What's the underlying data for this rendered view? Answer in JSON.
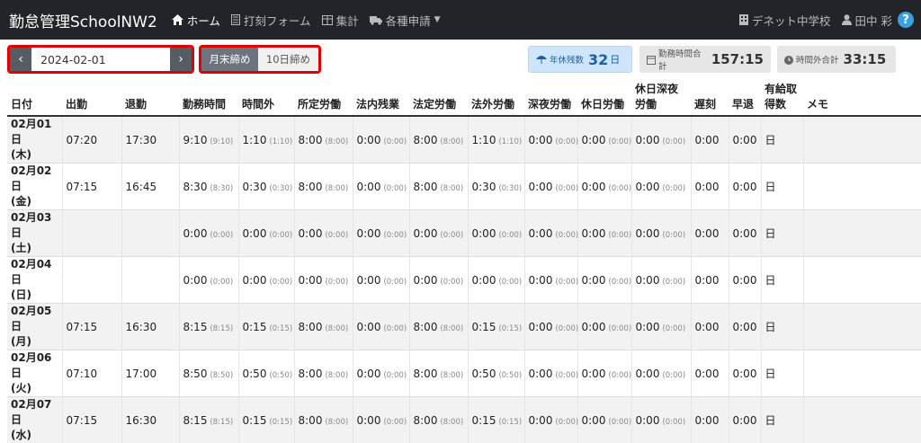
{
  "app": {
    "title": "勤怠管理SchoolNW2"
  },
  "nav": {
    "home": "ホーム",
    "punch": "打刻フォーム",
    "summary": "集計",
    "requests": "各種申請",
    "school": "デネット中学校",
    "user": "田中 彩",
    "help": "?"
  },
  "toolbar": {
    "date": "2024-02-01",
    "close_month_end": "月末締め",
    "close_10th": "10日締め"
  },
  "stats": {
    "annual_leave_label": "年休残数",
    "annual_leave_value": "32",
    "annual_leave_unit": "日",
    "work_total_label": "勤務時間合計",
    "work_total_value": "157:15",
    "overtime_total_label": "時間外合計",
    "overtime_total_value": "33:15"
  },
  "table": {
    "headers": [
      "日付",
      "出勤",
      "退勤",
      "勤務時間",
      "時間外",
      "所定労働",
      "法内残業",
      "法定労働",
      "法外労働",
      "深夜労働",
      "休日労働",
      "休日深夜労働",
      "遅刻",
      "早退",
      "有給取得数",
      "メモ"
    ],
    "rows": [
      {
        "date": "02月01日",
        "dow": "(木)",
        "in": "07:20",
        "out": "17:30",
        "work": "9:10",
        "work_s": "(9:10)",
        "ot": "1:10",
        "ot_s": "(1:10)",
        "sch": "8:00",
        "sch_s": "(8:00)",
        "inlaw": "0:00",
        "inlaw_s": "(0:00)",
        "legal": "8:00",
        "legal_s": "(8:00)",
        "outlaw": "1:10",
        "outlaw_s": "(1:10)",
        "night": "0:00",
        "night_s": "(0:00)",
        "hol": "0:00",
        "hol_s": "(0:00)",
        "holnight": "0:00",
        "holnight_s": "(0:00)",
        "late": "0:00",
        "early": "0:00",
        "paid": "日",
        "memo": ""
      },
      {
        "date": "02月02日",
        "dow": "(金)",
        "in": "07:15",
        "out": "16:45",
        "work": "8:30",
        "work_s": "(8:30)",
        "ot": "0:30",
        "ot_s": "(0:30)",
        "sch": "8:00",
        "sch_s": "(8:00)",
        "inlaw": "0:00",
        "inlaw_s": "(0:00)",
        "legal": "8:00",
        "legal_s": "(8:00)",
        "outlaw": "0:30",
        "outlaw_s": "(0:30)",
        "night": "0:00",
        "night_s": "(0:00)",
        "hol": "0:00",
        "hol_s": "(0:00)",
        "holnight": "0:00",
        "holnight_s": "(0:00)",
        "late": "0:00",
        "early": "0:00",
        "paid": "日",
        "memo": ""
      },
      {
        "date": "02月03日",
        "dow": "(土)",
        "in": "",
        "out": "",
        "work": "0:00",
        "work_s": "(0:00)",
        "ot": "0:00",
        "ot_s": "(0:00)",
        "sch": "0:00",
        "sch_s": "(0:00)",
        "inlaw": "0:00",
        "inlaw_s": "(0:00)",
        "legal": "0:00",
        "legal_s": "(0:00)",
        "outlaw": "0:00",
        "outlaw_s": "(0:00)",
        "night": "0:00",
        "night_s": "(0:00)",
        "hol": "0:00",
        "hol_s": "(0:00)",
        "holnight": "0:00",
        "holnight_s": "(0:00)",
        "late": "0:00",
        "early": "0:00",
        "paid": "日",
        "memo": ""
      },
      {
        "date": "02月04日",
        "dow": "(日)",
        "in": "",
        "out": "",
        "work": "0:00",
        "work_s": "(0:00)",
        "ot": "0:00",
        "ot_s": "(0:00)",
        "sch": "0:00",
        "sch_s": "(0:00)",
        "inlaw": "0:00",
        "inlaw_s": "(0:00)",
        "legal": "0:00",
        "legal_s": "(0:00)",
        "outlaw": "0:00",
        "outlaw_s": "(0:00)",
        "night": "0:00",
        "night_s": "(0:00)",
        "hol": "0:00",
        "hol_s": "(0:00)",
        "holnight": "0:00",
        "holnight_s": "(0:00)",
        "late": "0:00",
        "early": "0:00",
        "paid": "日",
        "memo": ""
      },
      {
        "date": "02月05日",
        "dow": "(月)",
        "in": "07:15",
        "out": "16:30",
        "work": "8:15",
        "work_s": "(8:15)",
        "ot": "0:15",
        "ot_s": "(0:15)",
        "sch": "8:00",
        "sch_s": "(8:00)",
        "inlaw": "0:00",
        "inlaw_s": "(0:00)",
        "legal": "8:00",
        "legal_s": "(8:00)",
        "outlaw": "0:15",
        "outlaw_s": "(0:15)",
        "night": "0:00",
        "night_s": "(0:00)",
        "hol": "0:00",
        "hol_s": "(0:00)",
        "holnight": "0:00",
        "holnight_s": "(0:00)",
        "late": "0:00",
        "early": "0:00",
        "paid": "日",
        "memo": ""
      },
      {
        "date": "02月06日",
        "dow": "(火)",
        "in": "07:10",
        "out": "17:00",
        "work": "8:50",
        "work_s": "(8:50)",
        "ot": "0:50",
        "ot_s": "(0:50)",
        "sch": "8:00",
        "sch_s": "(8:00)",
        "inlaw": "0:00",
        "inlaw_s": "(0:00)",
        "legal": "8:00",
        "legal_s": "(8:00)",
        "outlaw": "0:50",
        "outlaw_s": "(0:50)",
        "night": "0:00",
        "night_s": "(0:00)",
        "hol": "0:00",
        "hol_s": "(0:00)",
        "holnight": "0:00",
        "holnight_s": "(0:00)",
        "late": "0:00",
        "early": "0:00",
        "paid": "日",
        "memo": ""
      },
      {
        "date": "02月07日",
        "dow": "(水)",
        "in": "07:15",
        "out": "16:30",
        "work": "8:15",
        "work_s": "(8:15)",
        "ot": "0:15",
        "ot_s": "(0:15)",
        "sch": "8:00",
        "sch_s": "(8:00)",
        "inlaw": "0:00",
        "inlaw_s": "(0:00)",
        "legal": "8:00",
        "legal_s": "(8:00)",
        "outlaw": "0:15",
        "outlaw_s": "(0:15)",
        "night": "0:00",
        "night_s": "(0:00)",
        "hol": "0:00",
        "hol_s": "(0:00)",
        "holnight": "0:00",
        "holnight_s": "(0:00)",
        "late": "0:00",
        "early": "0:00",
        "paid": "日",
        "memo": ""
      }
    ]
  }
}
